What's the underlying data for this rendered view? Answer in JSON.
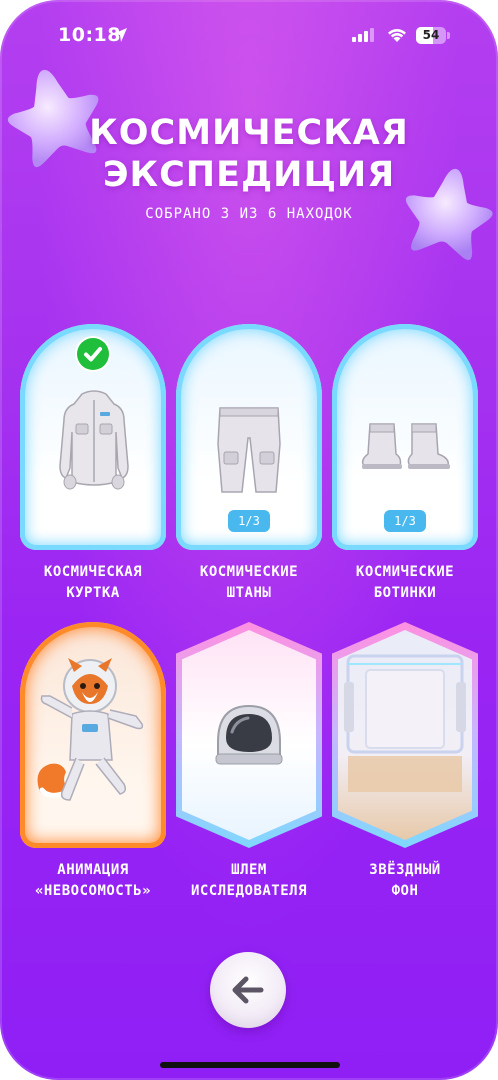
{
  "status_bar": {
    "time": "10:18",
    "battery": "54",
    "icons": [
      "location-arrow-icon",
      "signal-icon",
      "wifi-icon",
      "battery-icon"
    ]
  },
  "header": {
    "title_line1": "КОСМИЧЕСКАЯ",
    "title_line2": "ЭКСПЕДИЦИЯ",
    "subtitle": "СОБРАНО 3 ИЗ 6 НАХОДОК"
  },
  "items": [
    {
      "label_line1": "КОСМИЧЕСКАЯ",
      "label_line2": "КУРТКА",
      "status": "collected",
      "icon": "check-icon"
    },
    {
      "label_line1": "КОСМИЧЕСКИЕ",
      "label_line2": "ШТАНЫ",
      "progress": "1/3"
    },
    {
      "label_line1": "КОСМИЧЕСКИЕ",
      "label_line2": "БОТИНКИ",
      "progress": "1/3"
    },
    {
      "label_line1": "АНИМАЦИЯ",
      "label_line2": "«НЕВОСОМОСТЬ»"
    },
    {
      "label_line1": "ШЛЕМ",
      "label_line2": "ИССЛЕДОВАТЕЛЯ"
    },
    {
      "label_line1": "ЗВЁЗДНЫЙ",
      "label_line2": "ФОН"
    }
  ],
  "navigation": {
    "back_icon": "arrow-left-icon"
  },
  "colors": {
    "background_top": "#b43ff0",
    "background_bottom": "#8f1ff5",
    "card_border": "#79d9ff",
    "fox_card_border": "#ff8a2a",
    "check": "#1fbf3b",
    "badge": "#49b8ee"
  }
}
